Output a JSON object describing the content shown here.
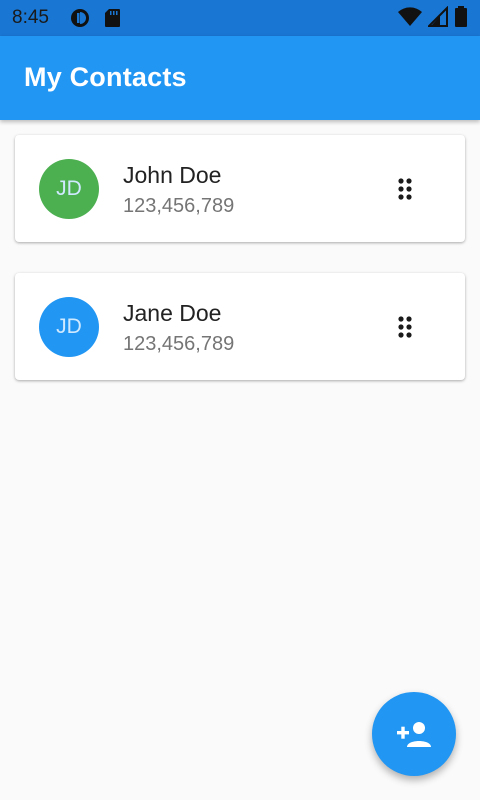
{
  "status_bar": {
    "time": "8:45",
    "left_icons": [
      "data-saver-icon",
      "sd-card-icon"
    ],
    "right_icons": [
      "wifi-icon",
      "signal-icon",
      "battery-icon"
    ]
  },
  "app_bar": {
    "title": "My Contacts",
    "color": "#2196f3"
  },
  "contacts": [
    {
      "initials": "JD",
      "name": "John Doe",
      "phone": "123,456,789",
      "avatar_color": "#4caf50",
      "menu_icon": "drag-dots-icon"
    },
    {
      "initials": "JD",
      "name": "Jane Doe",
      "phone": "123,456,789",
      "avatar_color": "#2196f3",
      "menu_icon": "drag-dots-icon"
    }
  ],
  "fab": {
    "icon": "person-add-icon",
    "color": "#2196f3"
  }
}
